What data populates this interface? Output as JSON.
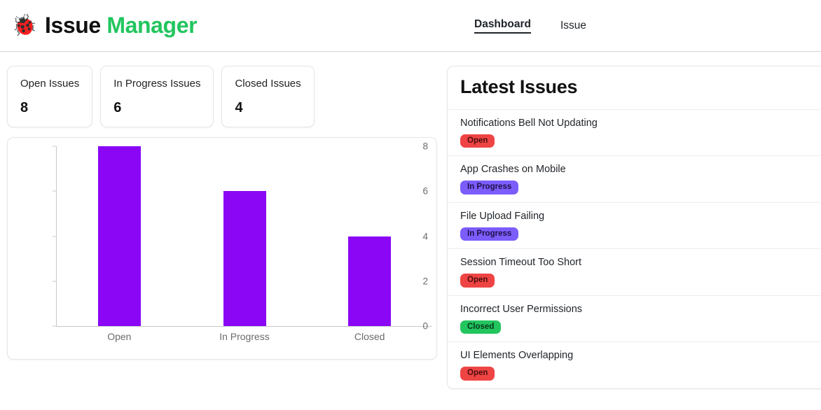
{
  "header": {
    "logo_icon": "bug-icon",
    "logo_glyph": "🐞",
    "title_primary": "Issue",
    "title_accent": "Manager",
    "accent_color": "#22c55e",
    "nav": [
      {
        "label": "Dashboard",
        "active": true
      },
      {
        "label": "Issue",
        "active": false
      }
    ]
  },
  "stats": [
    {
      "label": "Open Issues",
      "value": "8"
    },
    {
      "label": "In Progress Issues",
      "value": "6"
    },
    {
      "label": "Closed Issues",
      "value": "4"
    }
  ],
  "chart_data": {
    "type": "bar",
    "title": "",
    "xlabel": "",
    "ylabel": "",
    "categories": [
      "Open",
      "In Progress",
      "Closed"
    ],
    "values": [
      8,
      6,
      4
    ],
    "ylim": [
      0,
      8
    ],
    "yticks": [
      0,
      2,
      4,
      6,
      8
    ],
    "ytick_labels": [
      "0",
      "2",
      "4",
      "6",
      "8"
    ],
    "grid": false,
    "legend": "none",
    "bar_color": "#8a06f5"
  },
  "issues_panel": {
    "title": "Latest Issues",
    "items": [
      {
        "title": "Notifications Bell Not Updating",
        "status": "Open",
        "status_kind": "open"
      },
      {
        "title": "App Crashes on Mobile",
        "status": "In Progress",
        "status_kind": "progress"
      },
      {
        "title": "File Upload Failing",
        "status": "In Progress",
        "status_kind": "progress"
      },
      {
        "title": "Session Timeout Too Short",
        "status": "Open",
        "status_kind": "open"
      },
      {
        "title": "Incorrect User Permissions",
        "status": "Closed",
        "status_kind": "closed"
      },
      {
        "title": "UI Elements Overlapping",
        "status": "Open",
        "status_kind": "open"
      }
    ]
  }
}
